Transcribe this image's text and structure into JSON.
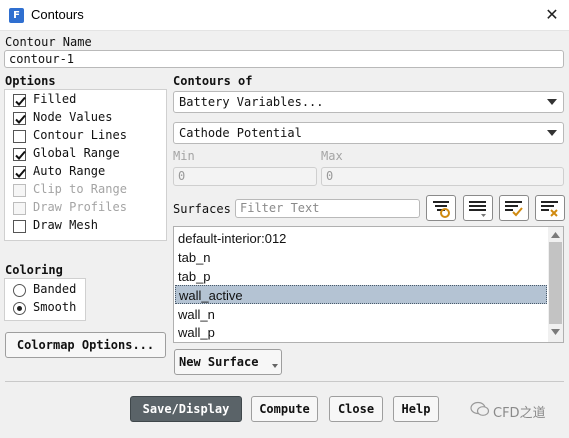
{
  "window": {
    "title": "Contours",
    "app_icon": "F"
  },
  "contour_name": {
    "label": "Contour Name",
    "value": "contour-1"
  },
  "options": {
    "header": "Options",
    "items": [
      {
        "label": "Filled",
        "checked": true,
        "enabled": true
      },
      {
        "label": "Node Values",
        "checked": true,
        "enabled": true
      },
      {
        "label": "Contour Lines",
        "checked": false,
        "enabled": true
      },
      {
        "label": "Global Range",
        "checked": true,
        "enabled": true
      },
      {
        "label": "Auto Range",
        "checked": true,
        "enabled": true
      },
      {
        "label": "Clip to Range",
        "checked": false,
        "enabled": false
      },
      {
        "label": "Draw Profiles",
        "checked": false,
        "enabled": false
      },
      {
        "label": "Draw Mesh",
        "checked": false,
        "enabled": true
      }
    ]
  },
  "coloring": {
    "header": "Coloring",
    "options": [
      {
        "label": "Banded",
        "selected": false
      },
      {
        "label": "Smooth",
        "selected": true
      }
    ]
  },
  "colormap_button": "Colormap Options...",
  "contours_of": {
    "label": "Contours of",
    "category": "Battery Variables...",
    "variable": "Cathode Potential"
  },
  "range": {
    "min_label": "Min",
    "min_value": "0",
    "max_label": "Max",
    "max_value": "0"
  },
  "surfaces": {
    "label": "Surfaces",
    "filter_placeholder": "Filter Text",
    "items": [
      "default-interior:012",
      "tab_n",
      "tab_p",
      "wall_active",
      "wall_n",
      "wall_p"
    ],
    "selected_index": 3
  },
  "new_surface_button": "New Surface",
  "actions": {
    "save_display": "Save/Display",
    "compute": "Compute",
    "close": "Close",
    "help": "Help"
  },
  "watermark": "CFD之道",
  "colors": {
    "selected_row": "#b4c3d3",
    "primary_button": "#5a6368",
    "app_icon": "#2f6fd0"
  }
}
